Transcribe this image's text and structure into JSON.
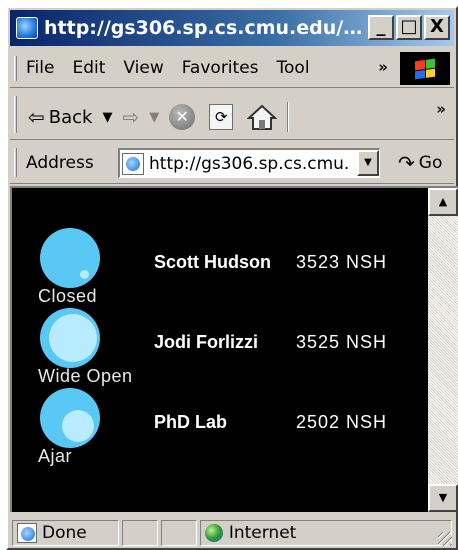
{
  "window": {
    "title": "http://gs306.sp.cs.cmu.edu/do...",
    "controls": {
      "minimize": "_",
      "maximize": "□",
      "close": "X"
    }
  },
  "menubar": {
    "items": [
      {
        "label": "File"
      },
      {
        "label": "Edit"
      },
      {
        "label": "View"
      },
      {
        "label": "Favorites"
      },
      {
        "label": "Tool"
      }
    ],
    "overflow": "»"
  },
  "navbar": {
    "back_label": "Back",
    "overflow": "»"
  },
  "addressbar": {
    "label": "Address",
    "url": "http://gs306.sp.cs.cmu.",
    "go_label": "Go"
  },
  "doors": [
    {
      "status": "Closed",
      "name": "Scott Hudson",
      "room": "3523 NSH",
      "state_icon": "door-closed",
      "open_fraction": 0.1
    },
    {
      "status": "Wide Open",
      "name": "Jodi Forlizzi",
      "room": "3525 NSH",
      "state_icon": "door-wide-open",
      "open_fraction": 0.9
    },
    {
      "status": "Ajar",
      "name": "PhD Lab",
      "room": "2502 NSH",
      "state_icon": "door-ajar",
      "open_fraction": 0.5
    }
  ],
  "colors": {
    "indicator_outer": "#5ac8f5",
    "indicator_inner": "#b8ebff",
    "page_background": "#000000"
  },
  "statusbar": {
    "status": "Done",
    "zone": "Internet"
  }
}
